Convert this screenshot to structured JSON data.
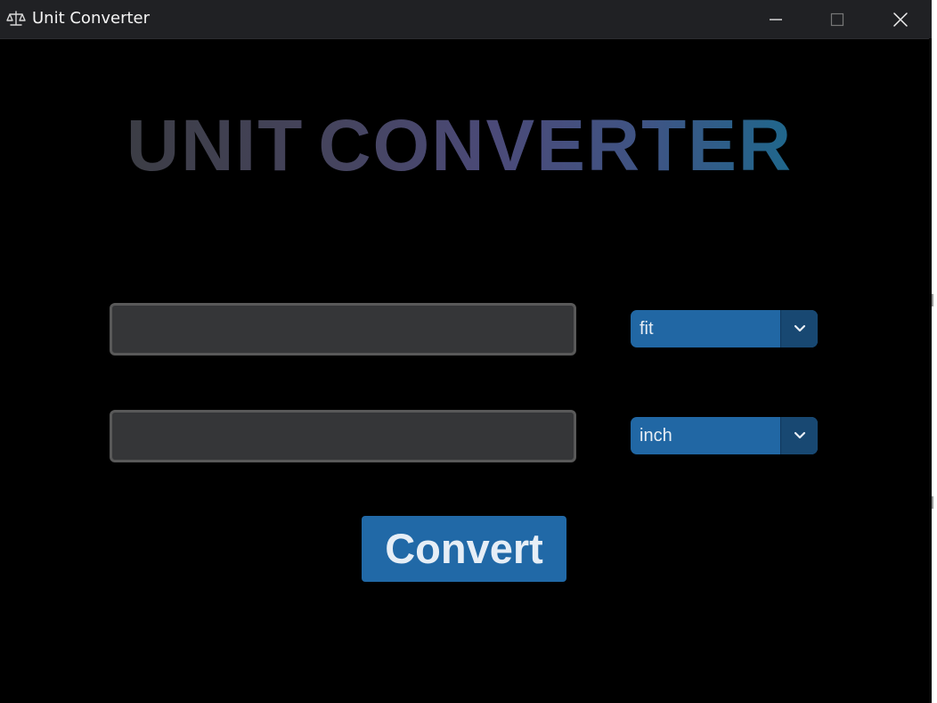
{
  "window": {
    "title": "Unit Converter",
    "app_icon": "scales-icon",
    "controls": [
      "minimize-icon",
      "maximize-icon",
      "close-icon"
    ]
  },
  "main": {
    "heading_word_1": "UNIT",
    "heading_word_2": "CONVERTER",
    "from_value": "",
    "to_value": "",
    "from_unit": "fit",
    "to_unit": "inch",
    "convert_label": "Convert"
  },
  "colors": {
    "background": "#000000",
    "titlebar": "#202124",
    "input_fill": "#353638",
    "input_border": "#595959",
    "accent": "#2167a4",
    "accent_dark": "#184872"
  }
}
